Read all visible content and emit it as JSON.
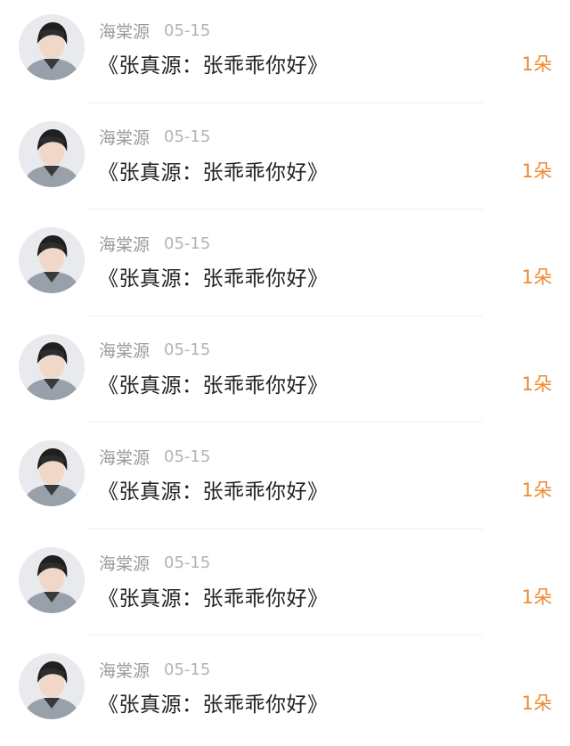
{
  "comments": [
    {
      "author": "海棠源",
      "date": "05-15",
      "title": "《张真源：张乖乖你好》",
      "gift_count": "1朵",
      "avatar_icon": "avatar-photo-icon"
    },
    {
      "author": "海棠源",
      "date": "05-15",
      "title": "《张真源：张乖乖你好》",
      "gift_count": "1朵",
      "avatar_icon": "avatar-photo-icon"
    },
    {
      "author": "海棠源",
      "date": "05-15",
      "title": "《张真源：张乖乖你好》",
      "gift_count": "1朵",
      "avatar_icon": "avatar-photo-icon"
    },
    {
      "author": "海棠源",
      "date": "05-15",
      "title": "《张真源：张乖乖你好》",
      "gift_count": "1朵",
      "avatar_icon": "avatar-photo-icon"
    },
    {
      "author": "海棠源",
      "date": "05-15",
      "title": "《张真源：张乖乖你好》",
      "gift_count": "1朵",
      "avatar_icon": "avatar-photo-icon"
    },
    {
      "author": "海棠源",
      "date": "05-15",
      "title": "《张真源：张乖乖你好》",
      "gift_count": "1朵",
      "avatar_icon": "avatar-photo-icon"
    },
    {
      "author": "海棠源",
      "date": "05-15",
      "title": "《张真源：张乖乖你好》",
      "gift_count": "1朵",
      "avatar_icon": "avatar-photo-icon"
    }
  ],
  "colors": {
    "author": "#9b9b9b",
    "date": "#b3b3b3",
    "title": "#222222",
    "gift_count": "#ef8a33",
    "divider": "#f0f0f0"
  }
}
